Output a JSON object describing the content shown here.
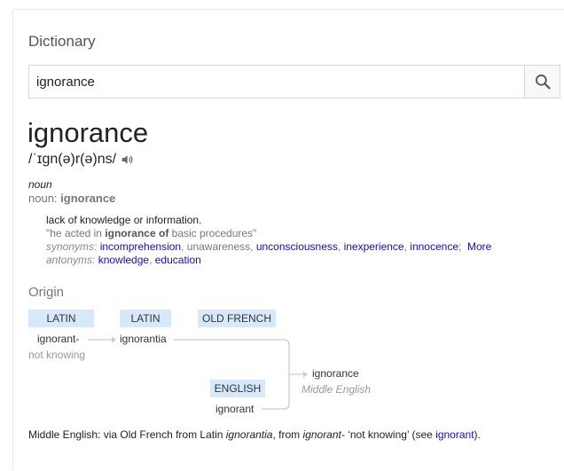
{
  "dictionary_title": "Dictionary",
  "search": {
    "value": "ignorance",
    "placeholder": "",
    "icon": "search-icon"
  },
  "entry": {
    "word": "ignorance",
    "phonetic": "/ˈɪɡn(ə)r(ə)ns/",
    "audio_icon": "speaker-icon",
    "pos_italic": "noun",
    "pos_prefix": "noun: ",
    "pos_word": "ignorance",
    "definition": "lack of knowledge or information.",
    "example": {
      "open": "\"he acted in ",
      "bold": "ignorance of",
      "close": " basic procedures\""
    },
    "synonyms_label": "synonyms:",
    "synonyms": [
      {
        "text": "incomprehension",
        "link": true
      },
      {
        "text": "unawareness",
        "link": false
      },
      {
        "text": "unconsciousness",
        "link": true
      },
      {
        "text": "inexperience",
        "link": true
      },
      {
        "text": "innocence",
        "link": true
      }
    ],
    "more_label": "More",
    "antonyms_label": "antonyms:",
    "antonyms": [
      {
        "text": "knowledge",
        "link": true
      },
      {
        "text": "education",
        "link": true
      }
    ]
  },
  "origin": {
    "title": "Origin",
    "tags": {
      "latin1": "LATIN",
      "latin2": "LATIN",
      "old_french": "OLD FRENCH",
      "english": "ENGLISH"
    },
    "words": {
      "ignorant_dash": "ignorant-",
      "not_knowing": "not knowing",
      "ignorantia": "ignorantia",
      "ignorant": "ignorant",
      "ignorance": "ignorance",
      "middle_english": "Middle English"
    },
    "line_color": "#cccccc"
  },
  "footnote": {
    "p1": "Middle English: via Old French from Latin ",
    "i1": "ignorantia",
    "p2": ", from ",
    "i2": "ignorant-",
    "p3": " ‘not knowing’ (see ",
    "link": "ignorant",
    "p4": ")."
  },
  "colors": {
    "link": "#1a0dab",
    "tag_bg": "#d6e9fa",
    "muted": "#777777"
  }
}
